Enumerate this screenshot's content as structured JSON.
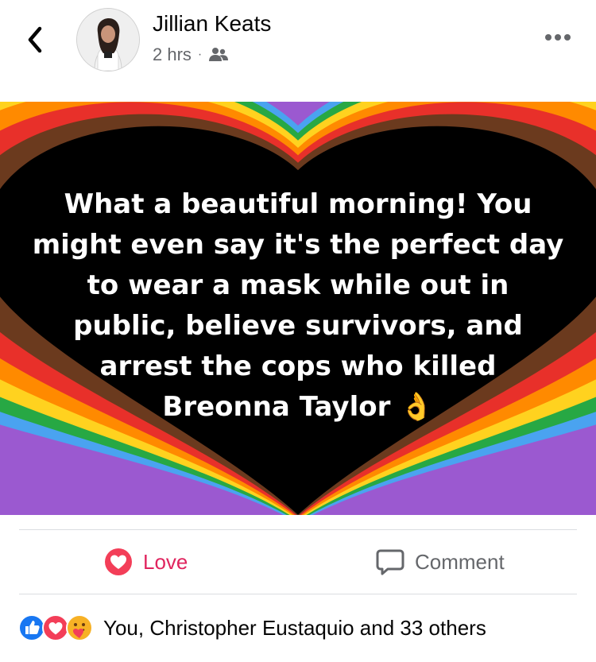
{
  "header": {
    "author_name": "Jillian Keats",
    "timestamp": "2 hrs",
    "separator": "·",
    "audience_icon": "friends-icon",
    "back_icon": "chevron-left-icon",
    "more_icon": "more-options-icon"
  },
  "post": {
    "text": "What a beautiful morning! You might even say it's the perfect day to wear a mask while out in public, believe survivors, and arrest the cops who killed Breonna Taylor",
    "emoji": "👌",
    "background_colors": [
      "#9b59d0",
      "#4aa3f0",
      "#27a844",
      "#ffd21f",
      "#ff8a00",
      "#e8302a",
      "#6b3a1e",
      "#000000"
    ]
  },
  "actions": {
    "love_label": "Love",
    "comment_label": "Comment",
    "love_color": "#e0245e",
    "comment_color": "#65676b"
  },
  "reactions": {
    "icons": [
      "like-icon",
      "love-icon",
      "care-icon"
    ],
    "summary": "You, Christopher Eustaquio and 33 others"
  }
}
